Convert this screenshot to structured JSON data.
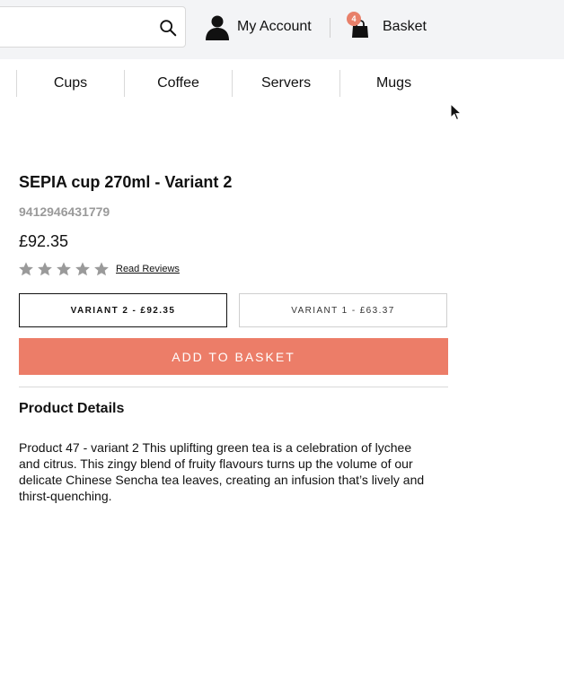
{
  "header": {
    "search": {
      "value": "",
      "placeholder": ""
    },
    "account_label": "My Account",
    "basket_label": "Basket",
    "basket_count": "4"
  },
  "nav": {
    "items": [
      {
        "label": "Cups"
      },
      {
        "label": "Coffee"
      },
      {
        "label": "Servers"
      },
      {
        "label": "Mugs"
      }
    ]
  },
  "product": {
    "title": "SEPIA cup 270ml - Variant 2",
    "sku": "9412946431779",
    "price": "£92.35",
    "rating": 0,
    "rating_max": 5,
    "read_reviews_label": "Read Reviews",
    "variants": [
      {
        "label": "VARIANT 2 - £92.35",
        "selected": true
      },
      {
        "label": "VARIANT 1 - £63.37",
        "selected": false
      }
    ],
    "add_to_basket_label": "ADD TO BASKET",
    "details_heading": "Product Details",
    "description": "Product 47 - variant 2 This uplifting green tea is a celebration of lychee and citrus. This zingy blend of fruity flavours turns up the volume of our delicate Chinese Sencha tea leaves, creating an infusion that’s lively and thirst-quenching."
  },
  "colors": {
    "accent": "#ec7d68",
    "badge": "#e8806a",
    "star_empty": "#9a9a9a",
    "header_bg": "#f3f4f6"
  },
  "icons": {
    "search": "search-icon",
    "account": "user-icon",
    "basket": "shopping-bag-icon",
    "star": "star-icon",
    "cursor": "mouse-cursor-icon"
  }
}
